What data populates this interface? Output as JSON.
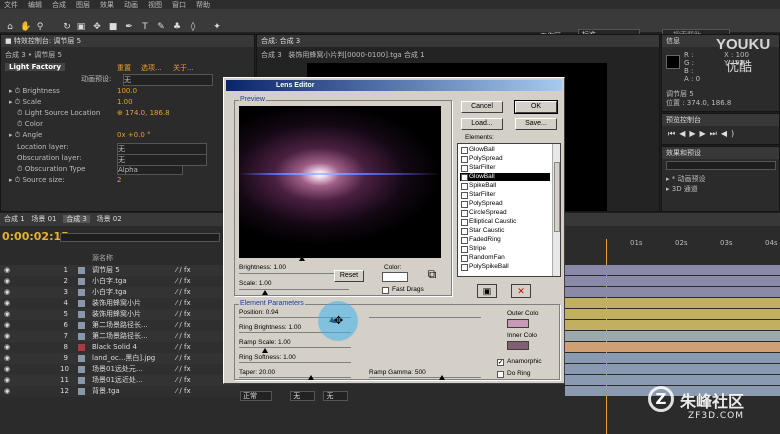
{
  "menubar": {
    "items": [
      "文件",
      "编辑",
      "合成",
      "图层",
      "效果",
      "动画",
      "视图",
      "窗口",
      "帮助"
    ]
  },
  "workspace": {
    "label": "工作区:",
    "value": "标准",
    "search_placeholder": "搜索帮助"
  },
  "effect_panel": {
    "tab1": "■ 特效控制台: 调节层 5",
    "breadcrumb": "合成 3 • 调节层 5",
    "effect_name": "Light Factory",
    "anim_preset_label": "动画预设:",
    "anim_preset_value": "无",
    "links": [
      "重置",
      "选项...",
      "关于..."
    ],
    "props": [
      {
        "label": "Brightness",
        "value": "100.0"
      },
      {
        "label": "Scale",
        "value": "1.00"
      },
      {
        "label": "Light Source Location",
        "value": "174.0, 186.8"
      },
      {
        "label": "Color",
        "value": ""
      },
      {
        "label": "Angle",
        "value": "0x +0.0 °"
      },
      {
        "label": "Location layer:",
        "value": "无"
      },
      {
        "label": "Obscuration layer:",
        "value": "无"
      },
      {
        "label": "Obscuration Type",
        "value": "Alpha"
      },
      {
        "label": "Source size:",
        "value": "2"
      }
    ]
  },
  "comp_panel": {
    "tab1": "合成: 合成 3",
    "tab2": "装饰用蜂窝小片判[0000-0100].tga 合成 1",
    "subtab": "合成 3"
  },
  "info_panel": {
    "tab": "信息",
    "r": "R :",
    "g": "G :",
    "b": "B :",
    "a": "A : 0",
    "x": "X : 100",
    "y": "Y : 92",
    "layer": "调节层 5",
    "pos": "位置 : 374.0, 186.8"
  },
  "preview_panel": {
    "tab": "预览控制台"
  },
  "effects_panel": {
    "tab": "效果和预设",
    "items": [
      "▸ * 动画预设",
      "▸ 3D 通道"
    ]
  },
  "timeline": {
    "tabs": [
      "合成 1",
      "场景 01",
      "合成 3",
      "场景 02"
    ],
    "timecode": "0:00:02:15",
    "col_name": "源名称",
    "ruler": [
      "01s",
      "02s",
      "03s",
      "04s"
    ],
    "layers": [
      {
        "num": "1",
        "name": "调节层 5",
        "color": "#8898a8",
        "bar": "#8a8aa8"
      },
      {
        "num": "2",
        "name": "小白字.tga",
        "color": "#8898a8",
        "bar": "#8a8aa8"
      },
      {
        "num": "3",
        "name": "小白字.tga",
        "color": "#8898a8",
        "bar": "#8a8aa8"
      },
      {
        "num": "4",
        "name": "装饰用蜂窝小片",
        "color": "#8898a8",
        "bar": "#c0b060"
      },
      {
        "num": "5",
        "name": "装饰用蜂窝小片",
        "color": "#8898a8",
        "bar": "#c0b060"
      },
      {
        "num": "6",
        "name": "第二场景路径长...",
        "color": "#8898a8",
        "bar": "#c0b060"
      },
      {
        "num": "7",
        "name": "第二场景路径长...",
        "color": "#8898a8",
        "bar": "#9aa8b0"
      },
      {
        "num": "8",
        "name": "Black Solid 4",
        "color": "#a04040",
        "bar": "#d0a070"
      },
      {
        "num": "9",
        "name": "land_oc...黑白].jpg",
        "color": "#8898a8",
        "bar": "#8a9ab0"
      },
      {
        "num": "10",
        "name": "场景01远处元...",
        "color": "#8898a8",
        "bar": "#8a9ab0"
      },
      {
        "num": "11",
        "name": "场景01远近处...",
        "color": "#8898a8",
        "bar": "#8a9ab0"
      },
      {
        "num": "12",
        "name": "背景.tga",
        "color": "#8898a8",
        "bar": "#8a9ab0"
      }
    ],
    "footer": [
      "正常",
      "无",
      "无"
    ]
  },
  "lens_editor": {
    "title": "Lens Editor",
    "preview_label": "Preview",
    "brightness": "Brightness: 1.00",
    "scale": "Scale: 1.00",
    "reset": "Reset",
    "color_label": "Color:",
    "fast_drags": "Fast Drags",
    "buttons": {
      "cancel": "Cancel",
      "ok": "OK",
      "load": "Load...",
      "save": "Save..."
    },
    "elements_label": "Elements:",
    "elements": [
      "GlowBall",
      "PolySpread",
      "StarFilter",
      "GlowBall",
      "SpikeBall",
      "StarFilter",
      "PolySpread",
      "CircleSpread",
      "Elliptical Caustic",
      "Star Caustic",
      "FadedRing",
      "Stripe",
      "RandomFan",
      "PolySpikeBall"
    ],
    "selected_element": 3,
    "params_label": "Element Parameters",
    "params": {
      "position": "Position:  0.94",
      "ring_brightness": "Ring Brightness:  1.00",
      "ramp_scale": "Ramp Scale:  1.00",
      "ring_softness": "Ring Softness:  1.00",
      "taper": "Taper:  20.00",
      "ramp_gamma": "Ramp Gamma:   500"
    },
    "outer_color": "Outer Colo",
    "inner_color": "Inner Colo",
    "anamorphic": "Anamorphic",
    "do_ring": "Do Ring"
  },
  "watermark": {
    "youku": "YOUKU",
    "youku_cn": "优酷",
    "site": "朱峰社区",
    "site_url": "ZF3D.COM"
  }
}
